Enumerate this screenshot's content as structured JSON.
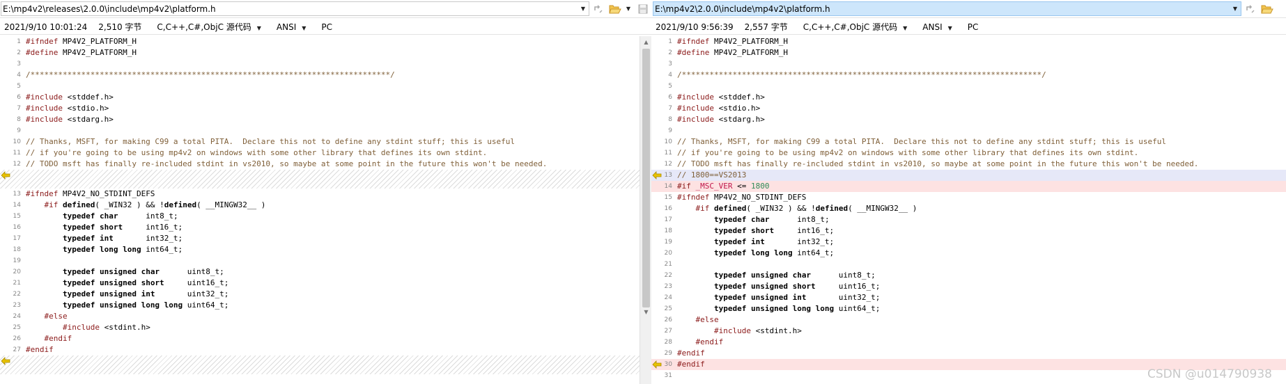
{
  "left": {
    "path": "E:\\mp4v2\\releases\\2.0.0\\include\\mp4v2\\platform.h",
    "date": "2021/9/10 10:01:24",
    "size": "2,510 字节",
    "syntax": "C,C++,C#,ObjC 源代码",
    "encoding": "ANSI",
    "eol": "PC",
    "lines": [
      {
        "n": "1",
        "s": "normal",
        "t": [
          [
            "k",
            "#ifndef"
          ],
          [
            "",
            " MP4V2_PLATFORM_H"
          ]
        ]
      },
      {
        "n": "2",
        "s": "normal",
        "t": [
          [
            "k",
            "#define"
          ],
          [
            "",
            " MP4V2_PLATFORM_H"
          ]
        ]
      },
      {
        "n": "3",
        "s": "normal",
        "t": []
      },
      {
        "n": "4",
        "s": "normal",
        "t": [
          [
            "c",
            "/******************************************************************************/"
          ]
        ]
      },
      {
        "n": "5",
        "s": "normal",
        "t": []
      },
      {
        "n": "6",
        "s": "normal",
        "t": [
          [
            "k",
            "#include"
          ],
          [
            "",
            " <stddef.h>"
          ]
        ]
      },
      {
        "n": "7",
        "s": "normal",
        "t": [
          [
            "k",
            "#include"
          ],
          [
            "",
            " <stdio.h>"
          ]
        ]
      },
      {
        "n": "8",
        "s": "normal",
        "t": [
          [
            "k",
            "#include"
          ],
          [
            "",
            " <stdarg.h>"
          ]
        ]
      },
      {
        "n": "9",
        "s": "normal",
        "t": []
      },
      {
        "n": "10",
        "s": "normal",
        "t": [
          [
            "c",
            "// Thanks, MSFT, for making C99 a total PITA.  Declare this not to define any stdint stuff; this is useful"
          ]
        ]
      },
      {
        "n": "11",
        "s": "normal",
        "t": [
          [
            "c",
            "// if you're going to be using mp4v2 on windows with some other library that defines its own stdint."
          ]
        ]
      },
      {
        "n": "12",
        "s": "normal",
        "t": [
          [
            "c",
            "// TODO msft has finally re-included stdint in vs2010, so maybe at some point in the future this won't be needed."
          ]
        ]
      },
      {
        "n": "",
        "s": "placeholder",
        "marker": true,
        "t": []
      },
      {
        "n": "13",
        "s": "normal",
        "t": [
          [
            "k",
            "#ifndef"
          ],
          [
            "",
            " MP4V2_NO_STDINT_DEFS"
          ]
        ]
      },
      {
        "n": "14",
        "s": "normal",
        "t": [
          [
            "",
            "    "
          ],
          [
            "k",
            "#if"
          ],
          [
            "",
            " "
          ],
          [
            "b",
            "defined"
          ],
          [
            "",
            "( _WIN32 ) && !"
          ],
          [
            "b",
            "defined"
          ],
          [
            "",
            "( __MINGW32__ )"
          ]
        ]
      },
      {
        "n": "15",
        "s": "normal",
        "t": [
          [
            "",
            "        "
          ],
          [
            "b",
            "typedef char"
          ],
          [
            "",
            "      int8_t;"
          ]
        ]
      },
      {
        "n": "16",
        "s": "normal",
        "t": [
          [
            "",
            "        "
          ],
          [
            "b",
            "typedef short"
          ],
          [
            "",
            "     int16_t;"
          ]
        ]
      },
      {
        "n": "17",
        "s": "normal",
        "t": [
          [
            "",
            "        "
          ],
          [
            "b",
            "typedef int"
          ],
          [
            "",
            "       int32_t;"
          ]
        ]
      },
      {
        "n": "18",
        "s": "normal",
        "t": [
          [
            "",
            "        "
          ],
          [
            "b",
            "typedef long long"
          ],
          [
            "",
            " int64_t;"
          ]
        ]
      },
      {
        "n": "19",
        "s": "normal",
        "t": []
      },
      {
        "n": "20",
        "s": "normal",
        "t": [
          [
            "",
            "        "
          ],
          [
            "b",
            "typedef unsigned char"
          ],
          [
            "",
            "      uint8_t;"
          ]
        ]
      },
      {
        "n": "21",
        "s": "normal",
        "t": [
          [
            "",
            "        "
          ],
          [
            "b",
            "typedef unsigned short"
          ],
          [
            "",
            "     uint16_t;"
          ]
        ]
      },
      {
        "n": "22",
        "s": "normal",
        "t": [
          [
            "",
            "        "
          ],
          [
            "b",
            "typedef unsigned int"
          ],
          [
            "",
            "       uint32_t;"
          ]
        ]
      },
      {
        "n": "23",
        "s": "normal",
        "t": [
          [
            "",
            "        "
          ],
          [
            "b",
            "typedef unsigned long long"
          ],
          [
            "",
            " uint64_t;"
          ]
        ]
      },
      {
        "n": "24",
        "s": "normal",
        "t": [
          [
            "",
            "    "
          ],
          [
            "k",
            "#else"
          ]
        ]
      },
      {
        "n": "25",
        "s": "normal",
        "t": [
          [
            "",
            "        "
          ],
          [
            "k",
            "#include"
          ],
          [
            "",
            " <stdint.h>"
          ]
        ]
      },
      {
        "n": "26",
        "s": "normal",
        "t": [
          [
            "",
            "    "
          ],
          [
            "k",
            "#endif"
          ]
        ]
      },
      {
        "n": "27",
        "s": "normal",
        "t": [
          [
            "k",
            "#endif"
          ]
        ]
      },
      {
        "n": "",
        "s": "placeholder",
        "marker": true,
        "t": []
      }
    ]
  },
  "right": {
    "path": "E:\\mp4v2\\2.0.0\\include\\mp4v2\\platform.h",
    "date": "2021/9/10 9:56:39",
    "size": "2,557 字节",
    "syntax": "C,C++,C#,ObjC 源代码",
    "encoding": "ANSI",
    "eol": "PC",
    "lines": [
      {
        "n": "1",
        "s": "normal",
        "t": [
          [
            "k",
            "#ifndef"
          ],
          [
            "",
            " MP4V2_PLATFORM_H"
          ]
        ]
      },
      {
        "n": "2",
        "s": "normal",
        "t": [
          [
            "k",
            "#define"
          ],
          [
            "",
            " MP4V2_PLATFORM_H"
          ]
        ]
      },
      {
        "n": "3",
        "s": "normal",
        "t": []
      },
      {
        "n": "4",
        "s": "normal",
        "t": [
          [
            "c",
            "/******************************************************************************/"
          ]
        ]
      },
      {
        "n": "5",
        "s": "normal",
        "t": []
      },
      {
        "n": "6",
        "s": "normal",
        "t": [
          [
            "k",
            "#include"
          ],
          [
            "",
            " <stddef.h>"
          ]
        ]
      },
      {
        "n": "7",
        "s": "normal",
        "t": [
          [
            "k",
            "#include"
          ],
          [
            "",
            " <stdio.h>"
          ]
        ]
      },
      {
        "n": "8",
        "s": "normal",
        "t": [
          [
            "k",
            "#include"
          ],
          [
            "",
            " <stdarg.h>"
          ]
        ]
      },
      {
        "n": "9",
        "s": "normal",
        "t": []
      },
      {
        "n": "10",
        "s": "normal",
        "t": [
          [
            "c",
            "// Thanks, MSFT, for making C99 a total PITA.  Declare this not to define any stdint stuff; this is useful"
          ]
        ]
      },
      {
        "n": "11",
        "s": "normal",
        "t": [
          [
            "c",
            "// if you're going to be using mp4v2 on windows with some other library that defines its own stdint."
          ]
        ]
      },
      {
        "n": "12",
        "s": "normal",
        "t": [
          [
            "c",
            "// TODO msft has finally re-included stdint in vs2010, so maybe at some point in the future this won't be needed."
          ]
        ]
      },
      {
        "n": "13",
        "s": "changed",
        "marker": true,
        "t": [
          [
            "c",
            "// 1800==VS2013"
          ]
        ]
      },
      {
        "n": "14",
        "s": "added",
        "t": [
          [
            "k",
            "#if"
          ],
          [
            "",
            " "
          ],
          [
            "m",
            "_MSC_VER"
          ],
          [
            "",
            " <= "
          ],
          [
            "n",
            "1800"
          ]
        ]
      },
      {
        "n": "15",
        "s": "normal",
        "t": [
          [
            "k",
            "#ifndef"
          ],
          [
            "",
            " MP4V2_NO_STDINT_DEFS"
          ]
        ]
      },
      {
        "n": "16",
        "s": "normal",
        "t": [
          [
            "",
            "    "
          ],
          [
            "k",
            "#if"
          ],
          [
            "",
            " "
          ],
          [
            "b",
            "defined"
          ],
          [
            "",
            "( _WIN32 ) && !"
          ],
          [
            "b",
            "defined"
          ],
          [
            "",
            "( __MINGW32__ )"
          ]
        ]
      },
      {
        "n": "17",
        "s": "normal",
        "t": [
          [
            "",
            "        "
          ],
          [
            "b",
            "typedef char"
          ],
          [
            "",
            "      int8_t;"
          ]
        ]
      },
      {
        "n": "18",
        "s": "normal",
        "t": [
          [
            "",
            "        "
          ],
          [
            "b",
            "typedef short"
          ],
          [
            "",
            "     int16_t;"
          ]
        ]
      },
      {
        "n": "19",
        "s": "normal",
        "t": [
          [
            "",
            "        "
          ],
          [
            "b",
            "typedef int"
          ],
          [
            "",
            "       int32_t;"
          ]
        ]
      },
      {
        "n": "20",
        "s": "normal",
        "t": [
          [
            "",
            "        "
          ],
          [
            "b",
            "typedef long long"
          ],
          [
            "",
            " int64_t;"
          ]
        ]
      },
      {
        "n": "21",
        "s": "normal",
        "t": []
      },
      {
        "n": "22",
        "s": "normal",
        "t": [
          [
            "",
            "        "
          ],
          [
            "b",
            "typedef unsigned char"
          ],
          [
            "",
            "      uint8_t;"
          ]
        ]
      },
      {
        "n": "23",
        "s": "normal",
        "t": [
          [
            "",
            "        "
          ],
          [
            "b",
            "typedef unsigned short"
          ],
          [
            "",
            "     uint16_t;"
          ]
        ]
      },
      {
        "n": "24",
        "s": "normal",
        "t": [
          [
            "",
            "        "
          ],
          [
            "b",
            "typedef unsigned int"
          ],
          [
            "",
            "       uint32_t;"
          ]
        ]
      },
      {
        "n": "25",
        "s": "normal",
        "t": [
          [
            "",
            "        "
          ],
          [
            "b",
            "typedef unsigned long long"
          ],
          [
            "",
            " uint64_t;"
          ]
        ]
      },
      {
        "n": "26",
        "s": "normal",
        "t": [
          [
            "",
            "    "
          ],
          [
            "k",
            "#else"
          ]
        ]
      },
      {
        "n": "27",
        "s": "normal",
        "t": [
          [
            "",
            "        "
          ],
          [
            "k",
            "#include"
          ],
          [
            "",
            " <stdint.h>"
          ]
        ]
      },
      {
        "n": "28",
        "s": "normal",
        "t": [
          [
            "",
            "    "
          ],
          [
            "k",
            "#endif"
          ]
        ]
      },
      {
        "n": "29",
        "s": "normal",
        "t": [
          [
            "k",
            "#endif"
          ]
        ]
      },
      {
        "n": "30",
        "s": "added",
        "marker": true,
        "t": [
          [
            "k",
            "#endif"
          ]
        ]
      },
      {
        "n": "31",
        "s": "normal",
        "t": []
      }
    ]
  },
  "watermark": "CSDN @u014790938",
  "colors": {
    "preprocessor": "#8b1a1a",
    "comment": "#7f5f38",
    "number": "#2e8b57",
    "macro": "#c0154a",
    "added_bg": "#fde2e2",
    "changed_bg": "#e6e8f8",
    "marker": "#e8c200",
    "selected_path_bg": "#cde6fb"
  },
  "icons": [
    "combo-dropdown-icon",
    "reload-icon",
    "open-folder-icon",
    "save-icon",
    "diff-arrow-icon"
  ]
}
